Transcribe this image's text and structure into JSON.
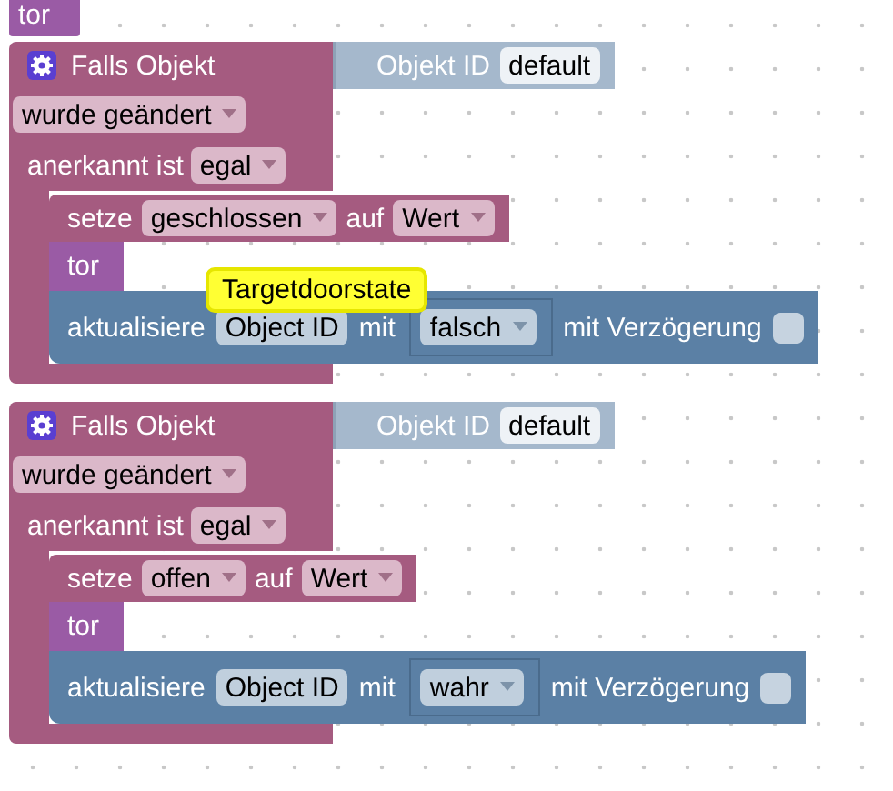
{
  "top_block": {
    "label": "tor"
  },
  "event_blocks": [
    {
      "title": "Falls Objekt",
      "object_label": "Objekt ID",
      "object_value": "default",
      "trigger": "wurde geändert",
      "ack_label": "anerkannt ist",
      "ack_value": "egal",
      "set_block": {
        "label": "setze",
        "variable": "geschlossen",
        "to_label": "auf",
        "value": "Wert"
      },
      "tor_label": "tor",
      "update_block": {
        "label": "aktualisiere",
        "object": "Object ID",
        "with_label": "mit",
        "value": "falsch",
        "delay_label": "mit Verzögerung",
        "delay_checked": false
      },
      "tooltip": "Targetdoorstate"
    },
    {
      "title": "Falls Objekt",
      "object_label": "Objekt ID",
      "object_value": "default",
      "trigger": "wurde geändert",
      "ack_label": "anerkannt ist",
      "ack_value": "egal",
      "set_block": {
        "label": "setze",
        "variable": "offen",
        "to_label": "auf",
        "value": "Wert"
      },
      "tor_label": "tor",
      "update_block": {
        "label": "aktualisiere",
        "object": "Object ID",
        "with_label": "mit",
        "value": "wahr",
        "delay_label": "mit Verzögerung",
        "delay_checked": false
      }
    }
  ]
}
